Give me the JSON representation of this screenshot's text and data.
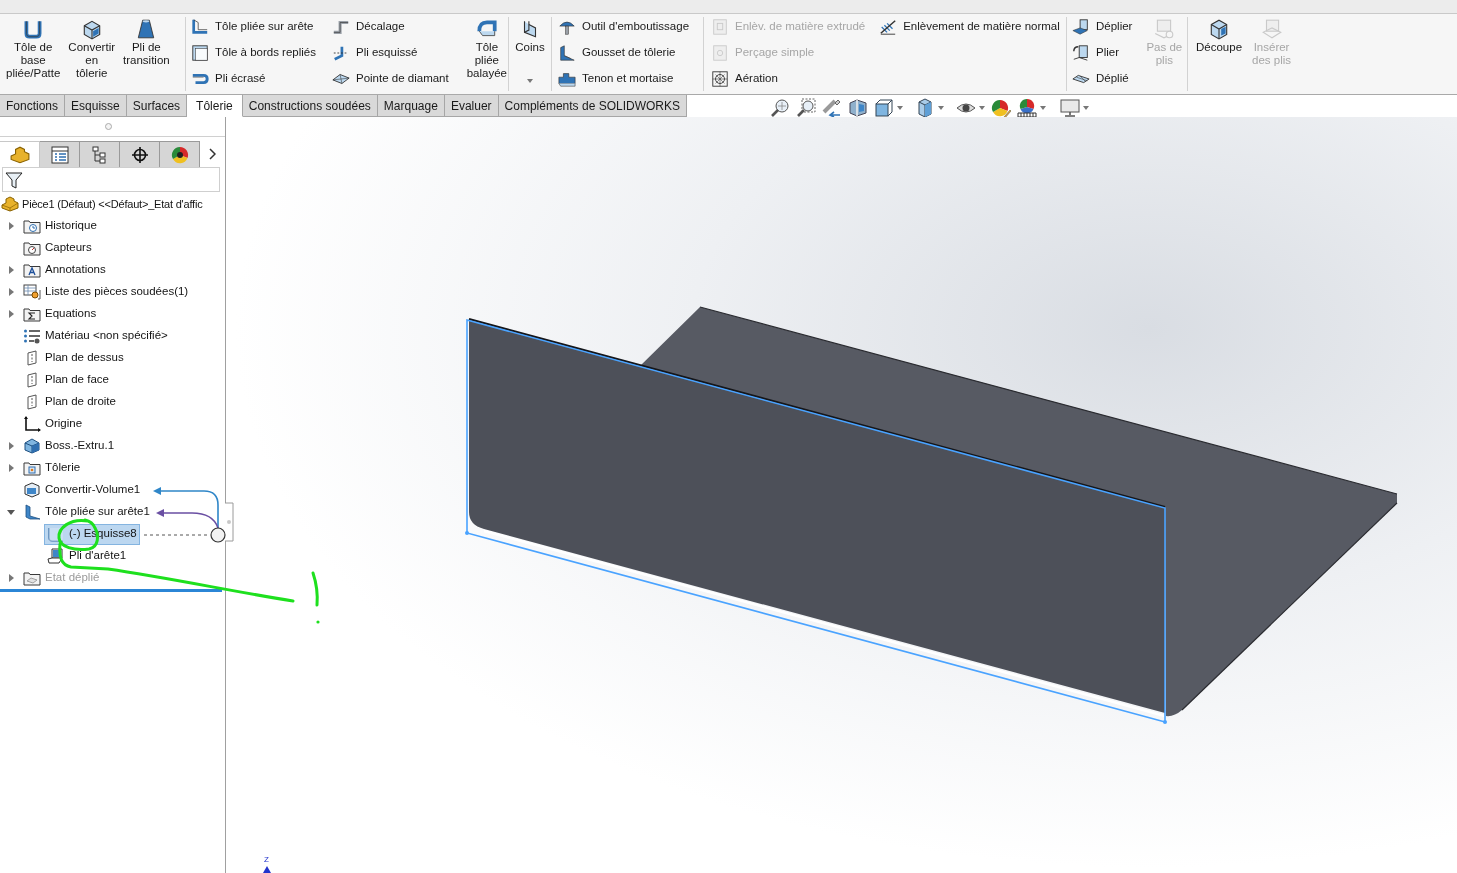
{
  "ribbon": {
    "groups": [
      {
        "columns": [
          {
            "kind": "large",
            "buttons": [
              {
                "kind": "base-flange",
                "label": "Tôle de\nbase\npliée/Patte",
                "disabled": false
              }
            ]
          },
          {
            "kind": "large",
            "buttons": [
              {
                "kind": "convert",
                "label": "Convertir\nen\ntôlerie",
                "disabled": false
              }
            ]
          },
          {
            "kind": "large",
            "buttons": [
              {
                "kind": "transition",
                "label": "Pli de\ntransition",
                "disabled": false
              }
            ]
          }
        ]
      },
      {
        "columns": [
          {
            "kind": "stack",
            "buttons": [
              {
                "kind": "edge-flange",
                "label": "Tôle pliée sur arête",
                "disabled": false
              },
              {
                "kind": "miter-flange",
                "label": "Tôle à bords repliés",
                "disabled": false
              },
              {
                "kind": "hem",
                "label": "Pli écrasé",
                "disabled": false
              }
            ]
          },
          {
            "kind": "stack",
            "buttons": [
              {
                "kind": "jog",
                "label": "Décalage",
                "disabled": false
              },
              {
                "kind": "sketched-bend",
                "label": "Pli esquissé",
                "disabled": false
              },
              {
                "kind": "cross-break",
                "label": "Pointe de diamant",
                "disabled": false
              }
            ]
          },
          {
            "kind": "large",
            "buttons": [
              {
                "kind": "swept-flange",
                "label": "Tôle\npliée\nbalayée",
                "disabled": false
              }
            ]
          }
        ]
      },
      {
        "columns": [
          {
            "kind": "large",
            "buttons": [
              {
                "kind": "corners",
                "label": "Coins",
                "disabled": false,
                "dropdown": true
              }
            ]
          }
        ]
      },
      {
        "columns": [
          {
            "kind": "stack",
            "buttons": [
              {
                "kind": "forming-tool",
                "label": "Outil d'emboutissage",
                "disabled": false
              },
              {
                "kind": "gusset",
                "label": "Gousset de tôlerie",
                "disabled": false
              },
              {
                "kind": "tab-slot",
                "label": "Tenon et mortaise",
                "disabled": false
              }
            ]
          }
        ]
      },
      {
        "columns": [
          {
            "kind": "stack",
            "buttons": [
              {
                "kind": "extruded-cut",
                "label": "Enlèv. de matière extrudé",
                "disabled": true
              },
              {
                "kind": "simple-hole",
                "label": "Perçage simple",
                "disabled": true
              },
              {
                "kind": "vent",
                "label": "Aération",
                "disabled": false
              }
            ]
          },
          {
            "kind": "stack",
            "buttons": [
              {
                "kind": "normal-cut",
                "label": "Enlèvement de matière normal",
                "disabled": false
              }
            ]
          }
        ]
      },
      {
        "columns": [
          {
            "kind": "stack",
            "buttons": [
              {
                "kind": "unfold",
                "label": "Déplier",
                "disabled": false
              },
              {
                "kind": "fold",
                "label": "Plier",
                "disabled": false
              },
              {
                "kind": "flatten",
                "label": "Déplié",
                "disabled": false
              }
            ]
          },
          {
            "kind": "large",
            "buttons": [
              {
                "kind": "no-bends",
                "label": "Pas de\nplis",
                "disabled": true
              }
            ]
          }
        ]
      },
      {
        "columns": [
          {
            "kind": "large",
            "buttons": [
              {
                "kind": "rip",
                "label": "Découpe",
                "disabled": false
              }
            ]
          },
          {
            "kind": "large",
            "buttons": [
              {
                "kind": "insert-bends",
                "label": "Insérer\ndes plis",
                "disabled": true
              }
            ]
          }
        ]
      }
    ]
  },
  "command_tabs": [
    {
      "label": "Fonctions",
      "selected": false
    },
    {
      "label": "Esquisse",
      "selected": false
    },
    {
      "label": "Surfaces",
      "selected": false
    },
    {
      "label": "Tôlerie",
      "selected": true
    },
    {
      "label": "Constructions soudées",
      "selected": false
    },
    {
      "label": "Marquage",
      "selected": false
    },
    {
      "label": "Evaluer",
      "selected": false
    },
    {
      "label": "Compléments de SOLIDWORKS",
      "selected": false
    }
  ],
  "panel_tabs": [
    {
      "kind": "feature-manager",
      "selected": true
    },
    {
      "kind": "property-manager",
      "selected": false
    },
    {
      "kind": "configuration-manager",
      "selected": false
    },
    {
      "kind": "dimxpert-manager",
      "selected": false
    },
    {
      "kind": "display-manager",
      "selected": false
    }
  ],
  "feature_tree": {
    "root": {
      "kind": "part",
      "label": "Pièce1 (Défaut) <<Défaut>_Etat d'affic"
    },
    "items": [
      {
        "kind": "history-folder",
        "label": "Historique",
        "expandable": true,
        "expanded": false,
        "selected": false,
        "disabled": false
      },
      {
        "kind": "sensor-folder",
        "label": "Capteurs",
        "expandable": false,
        "selected": false,
        "disabled": false
      },
      {
        "kind": "annotation-folder",
        "label": "Annotations",
        "expandable": true,
        "expanded": false,
        "selected": false,
        "disabled": false
      },
      {
        "kind": "cut-list",
        "label": "Liste des pièces soudées(1)",
        "expandable": true,
        "expanded": false,
        "selected": false,
        "disabled": false
      },
      {
        "kind": "equation-folder",
        "label": "Equations",
        "expandable": true,
        "expanded": false,
        "selected": false,
        "disabled": false
      },
      {
        "kind": "material",
        "label": "Matériau <non spécifié>",
        "expandable": false,
        "selected": false,
        "disabled": false
      },
      {
        "kind": "plane",
        "label": "Plan de dessus",
        "expandable": false,
        "selected": false,
        "disabled": false
      },
      {
        "kind": "plane",
        "label": "Plan de face",
        "expandable": false,
        "selected": false,
        "disabled": false
      },
      {
        "kind": "plane",
        "label": "Plan de droite",
        "expandable": false,
        "selected": false,
        "disabled": false
      },
      {
        "kind": "origin",
        "label": "Origine",
        "expandable": false,
        "selected": false,
        "disabled": false
      },
      {
        "kind": "extrude",
        "label": "Boss.-Extru.1",
        "expandable": true,
        "expanded": false,
        "selected": false,
        "disabled": false
      },
      {
        "kind": "sheet-metal-folder",
        "label": "Tôlerie",
        "expandable": true,
        "expanded": false,
        "selected": false,
        "disabled": false
      },
      {
        "kind": "convert",
        "label": "Convertir-Volume1",
        "expandable": false,
        "selected": false,
        "disabled": false
      },
      {
        "kind": "edge-flange",
        "label": "Tôle pliée sur arête1",
        "expandable": true,
        "expanded": true,
        "selected": false,
        "disabled": false,
        "children": [
          {
            "kind": "sketch",
            "label": "(-) Esquisse8",
            "expandable": false,
            "selected": true,
            "disabled": false
          },
          {
            "kind": "edge-bend",
            "label": "Pli d'arête1",
            "expandable": false,
            "selected": false,
            "disabled": false
          }
        ]
      },
      {
        "kind": "flat-pattern",
        "label": "Etat déplié",
        "expandable": true,
        "expanded": false,
        "selected": false,
        "disabled": true
      }
    ]
  },
  "viewport": {
    "axis_label": "Z"
  }
}
